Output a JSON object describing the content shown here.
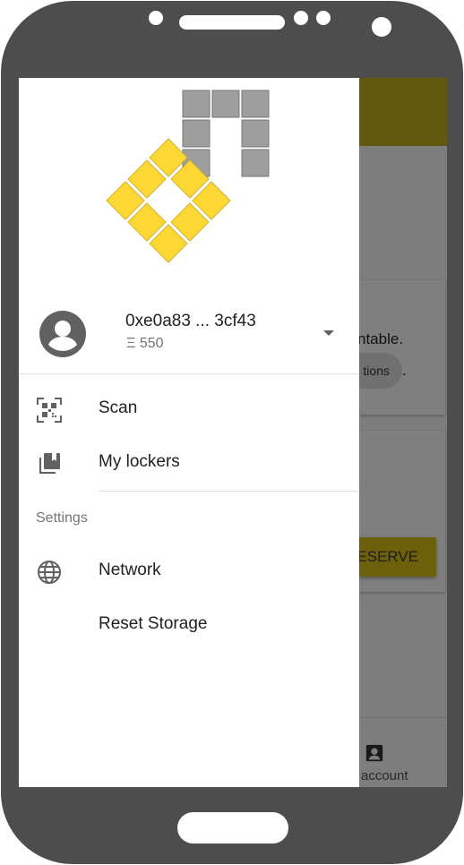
{
  "background_app": {
    "partial_text": "ntable.",
    "chip_label": "tions",
    "chip_suffix": ".",
    "reserve_button": "ESERVE",
    "nav_account_label": "account"
  },
  "drawer": {
    "account": {
      "address": "0xe0a83 ... 3cf43",
      "balance": "Ξ 550"
    },
    "menu": [
      {
        "label": "Scan",
        "icon": "qr-code-scan-icon"
      },
      {
        "label": "My lockers",
        "icon": "library-books-icon"
      }
    ],
    "settings_header": "Settings",
    "settings_menu": [
      {
        "label": "Network",
        "icon": "globe-icon"
      },
      {
        "label": "Reset Storage",
        "icon": ""
      }
    ]
  },
  "colors": {
    "brand_yellow": "#FDD835",
    "app_bar": "#C6B21D",
    "device_frame": "#4D4D4D"
  }
}
